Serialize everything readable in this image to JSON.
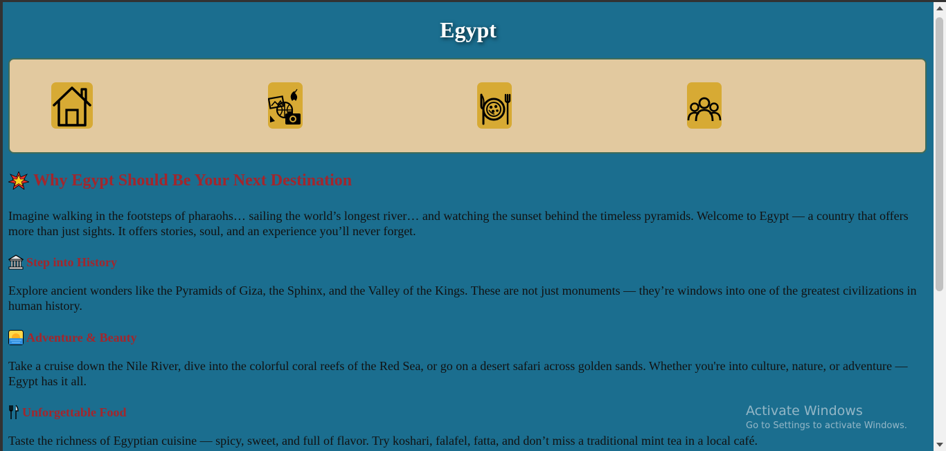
{
  "header": {
    "title": "Egypt"
  },
  "nav": {
    "items": [
      {
        "icon": "home-icon"
      },
      {
        "icon": "travel-collage-icon"
      },
      {
        "icon": "food-plate-icon"
      },
      {
        "icon": "people-group-icon"
      }
    ]
  },
  "article": {
    "heading_emoji": "star-icon",
    "heading": "Why Egypt Should Be Your Next Destination",
    "intro": "Imagine walking in the footsteps of pharaohs… sailing the world’s longest river… and watching the sunset behind the timeless pyramids. Welcome to Egypt — a country that offers more than just sights. It offers stories, soul, and an experience you’ll never forget.",
    "sections": [
      {
        "emoji": "classical-building-icon",
        "title": "Step into History",
        "text": "Explore ancient wonders like the Pyramids of Giza, the Sphinx, and the Valley of the Kings. These are not just monuments — they’re windows into one of the greatest civilizations in human history."
      },
      {
        "emoji": "sunrise-icon",
        "title": "Adventure & Beauty",
        "text": "Take a cruise down the Nile River, dive into the colorful coral reefs of the Red Sea, or go on a desert safari across golden sands. Whether you're into culture, nature, or adventure — Egypt has it all."
      },
      {
        "emoji": "fork-knife-icon",
        "title": "Unforgettable Food",
        "text": "Taste the richness of Egyptian cuisine — spicy, sweet, and full of flavor. Try koshari, falafel, fatta, and don’t miss a traditional mint tea in a local café."
      }
    ]
  },
  "watermark": {
    "title": "Activate Windows",
    "subtitle": "Go to Settings to activate Windows."
  },
  "colors": {
    "page_background": "#1b6e8f",
    "nav_background": "#e2c99f",
    "icon_background": "#d7aa34",
    "heading_red": "#a3262c",
    "title_white": "#ffffff"
  }
}
